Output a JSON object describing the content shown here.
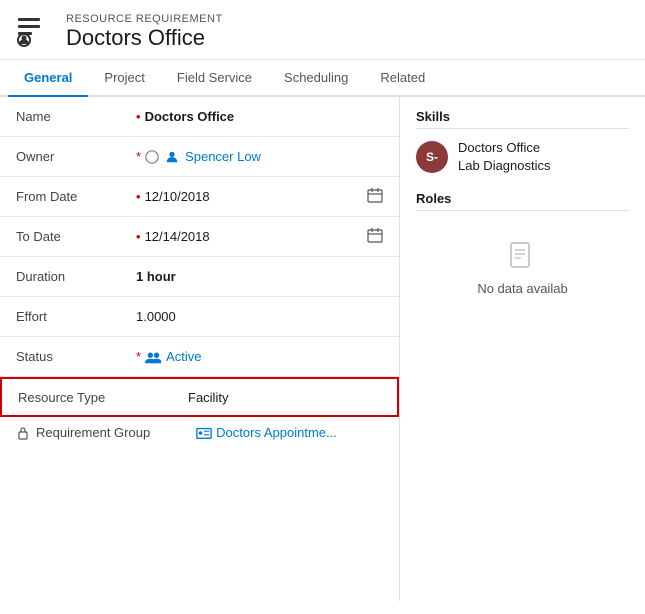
{
  "header": {
    "subtitle": "RESOURCE REQUIREMENT",
    "title": "Doctors Office"
  },
  "tabs": [
    {
      "label": "General",
      "active": true
    },
    {
      "label": "Project",
      "active": false
    },
    {
      "label": "Field Service",
      "active": false
    },
    {
      "label": "Scheduling",
      "active": false
    },
    {
      "label": "Related",
      "active": false
    }
  ],
  "form": {
    "name_label": "Name",
    "name_value": "Doctors Office",
    "owner_label": "Owner",
    "owner_value": "Spencer Low",
    "from_date_label": "From Date",
    "from_date_value": "12/10/2018",
    "to_date_label": "To Date",
    "to_date_value": "12/14/2018",
    "duration_label": "Duration",
    "duration_value": "1 hour",
    "effort_label": "Effort",
    "effort_value": "1.0000",
    "status_label": "Status",
    "status_value": "Active",
    "resource_type_label": "Resource Type",
    "resource_type_value": "Facility",
    "req_group_label": "Requirement Group",
    "req_group_value": "Doctors Appointme..."
  },
  "skills": {
    "title": "Skills",
    "item": {
      "initials": "S-",
      "text_line1": "Doctors Office",
      "text_line2": "Lab Diagnostics"
    }
  },
  "roles": {
    "title": "Roles",
    "no_data": "No data availab"
  }
}
